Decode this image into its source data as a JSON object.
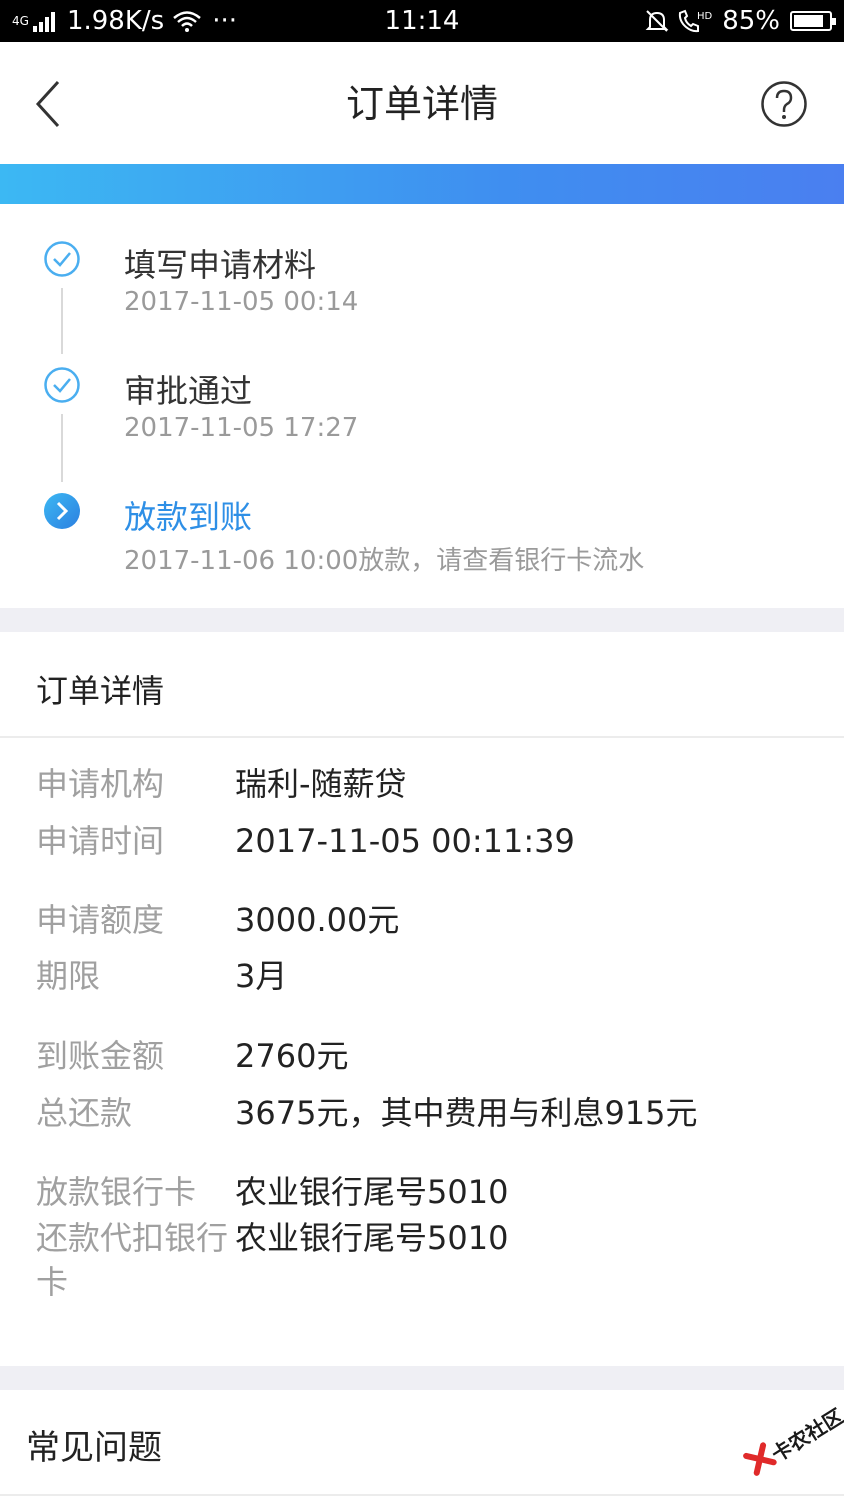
{
  "status_bar": {
    "network": "4G",
    "speed": "1.98K/s",
    "more": "···",
    "time": "11:14",
    "hd": "HD",
    "battery": "85%",
    "battery_level": 0.85
  },
  "nav": {
    "title": "订单详情"
  },
  "timeline": {
    "steps": [
      {
        "label": "填写申请材料",
        "time": "2017-11-05 00:14",
        "state": "done"
      },
      {
        "label": "审批通过",
        "time": "2017-11-05 17:27",
        "state": "done"
      },
      {
        "label": "放款到账",
        "time": "2017-11-06 10:00放款，请查看银行卡流水",
        "state": "current"
      }
    ]
  },
  "details": {
    "heading": "订单详情",
    "rows": [
      {
        "key": "申请机构",
        "value": "瑞利-随薪贷"
      },
      {
        "key": "申请时间",
        "value": "2017-11-05 00:11:39"
      },
      {
        "key": "申请额度",
        "value": "3000.00元"
      },
      {
        "key": "期限",
        "value": "3月"
      },
      {
        "key": "到账金额",
        "value": "2760元"
      },
      {
        "key": "总还款",
        "value": "3675元，其中费用与利息915元"
      },
      {
        "key": "放款银行卡",
        "value": "农业银行尾号5010"
      },
      {
        "key": "还款代扣银行卡",
        "value": "农业银行尾号5010"
      }
    ]
  },
  "faq": {
    "label": "常见问题"
  },
  "watermark": {
    "text": "卡农社区"
  },
  "colors": {
    "accent": "#2e8fe6",
    "check": "#4aaef0",
    "gradient_start": "#3cb8f3",
    "gradient_end": "#4a7ff0"
  }
}
